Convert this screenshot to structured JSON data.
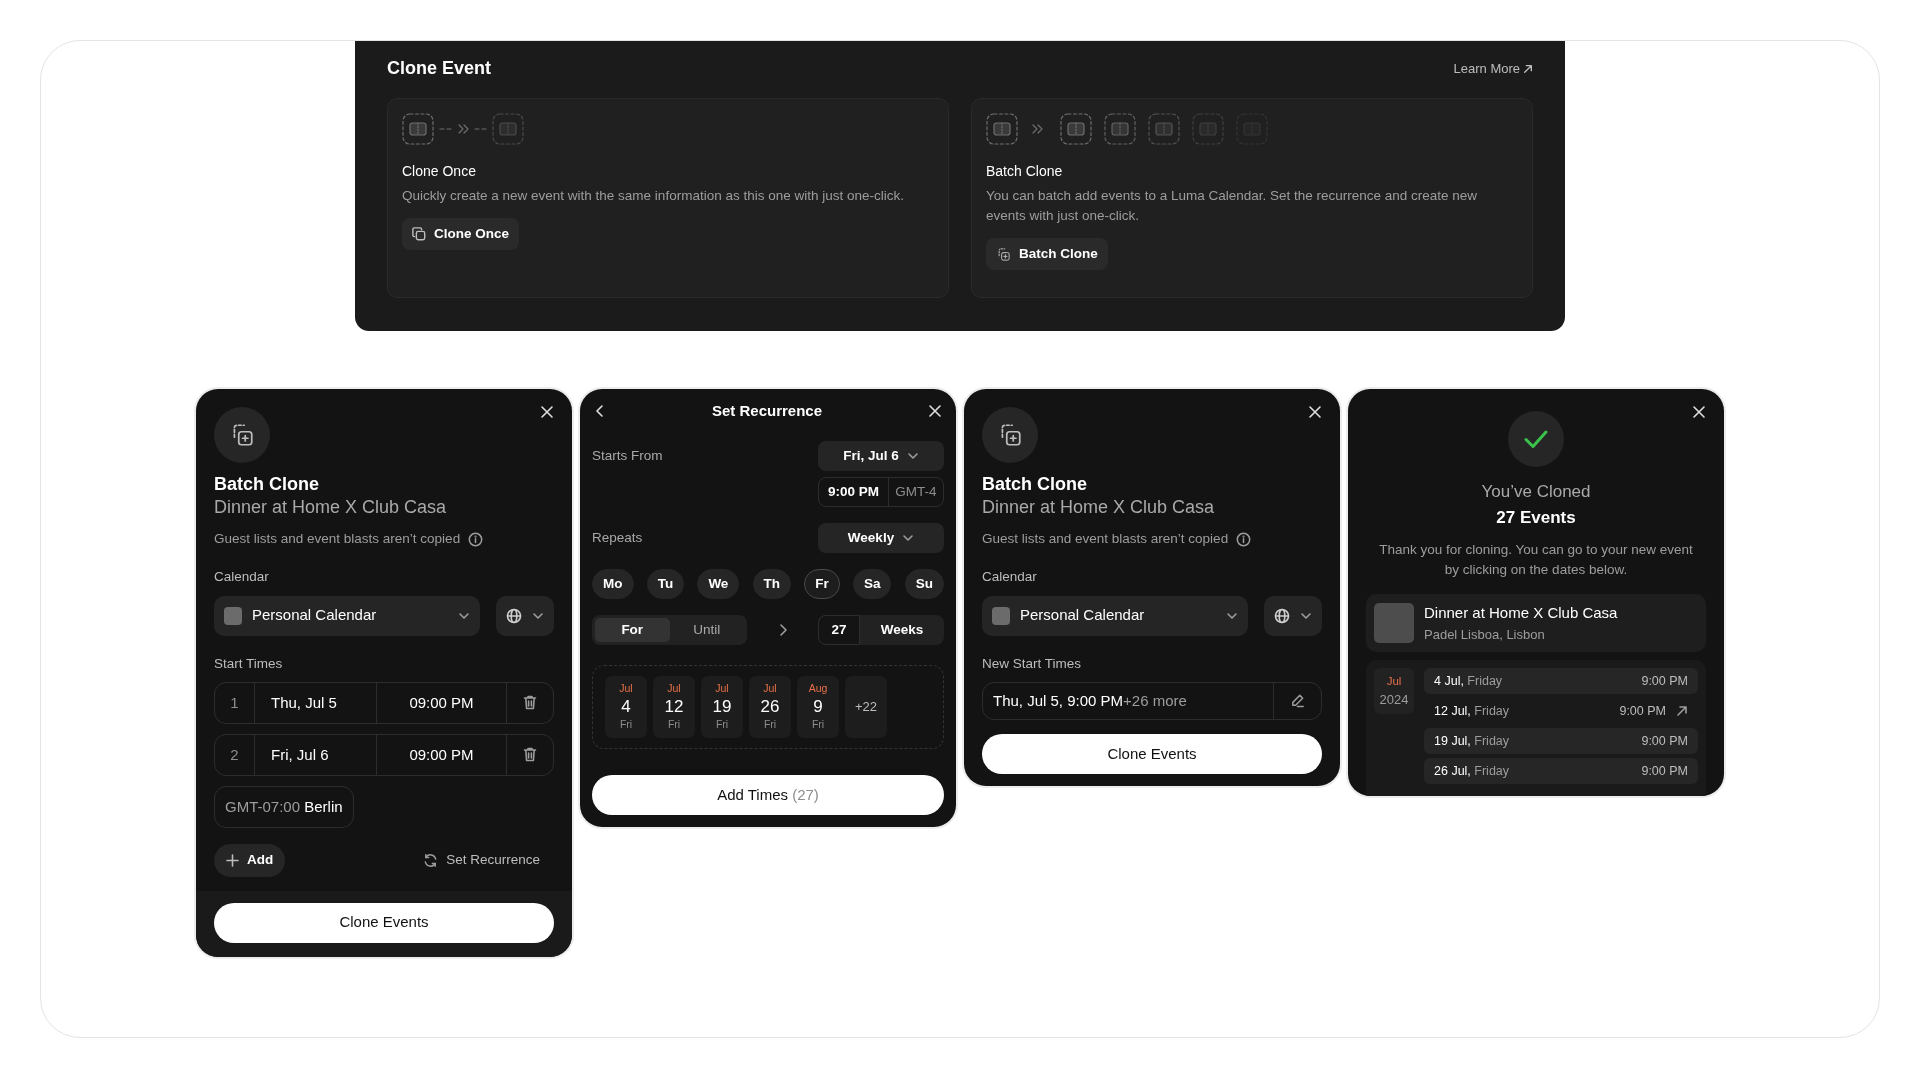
{
  "clone_event": {
    "title": "Clone Event",
    "learn_more": "Learn More",
    "options": [
      {
        "kind": "once",
        "title": "Clone Once",
        "description": "Quickly create a new event with the same information as this one with just one-click.",
        "button": "Clone Once"
      },
      {
        "kind": "batch",
        "title": "Batch Clone",
        "description": "You can batch add events to a Luma Calendar. Set the recurrence and create new events with just one-click.",
        "button": "Batch Clone"
      }
    ]
  },
  "batch_clone_form": {
    "title": "Batch Clone",
    "event_name": "Dinner at Home X Club Casa",
    "note": "Guest lists and event blasts aren’t copied",
    "calendar_label": "Calendar",
    "calendar": "Personal Calendar",
    "start_times_label": "Start Times",
    "start_times": [
      {
        "index": "1",
        "date": "Thu, Jul 5",
        "time": "09:00 PM"
      },
      {
        "index": "2",
        "date": "Fri, Jul 6",
        "time": "09:00 PM"
      }
    ],
    "timezone": "GMT-07:00 **Berlin**",
    "add_button": "Add",
    "recurrence_button": "Set Recurrence",
    "submit_button": "Clone Events"
  },
  "set_recurrence": {
    "title": "Set Recurrence",
    "starts_from_label": "Starts From",
    "start_date": "Fri, Jul 6",
    "start_time": "9:00 PM",
    "timezone": "GMT-4",
    "repeats_label": "Repeats",
    "repeats": "Weekly",
    "weekdays": [
      {
        "label": "Mo",
        "selected": false
      },
      {
        "label": "Tu",
        "selected": false
      },
      {
        "label": "We",
        "selected": false
      },
      {
        "label": "Th",
        "selected": false
      },
      {
        "label": "Fr",
        "selected": true
      },
      {
        "label": "Sa",
        "selected": false
      },
      {
        "label": "Su",
        "selected": false
      }
    ],
    "end_modes": [
      {
        "label": "For",
        "selected": true
      },
      {
        "label": "Until",
        "selected": false
      }
    ],
    "count": "27",
    "unit": "Weeks",
    "preview": [
      {
        "month": "Jul",
        "day": "4",
        "weekday": "Fri"
      },
      {
        "month": "Jul",
        "day": "12",
        "weekday": "Fri"
      },
      {
        "month": "Jul",
        "day": "19",
        "weekday": "Fri"
      },
      {
        "month": "Jul",
        "day": "26",
        "weekday": "Fri"
      },
      {
        "month": "Aug",
        "day": "9",
        "weekday": "Fri"
      }
    ],
    "more": "+22",
    "submit_label": "Add Times",
    "submit_count": "(27)"
  },
  "batch_clone_summary": {
    "title": "Batch Clone",
    "event_name": "Dinner at Home X Club Casa",
    "note": "Guest lists and event blasts aren’t copied",
    "calendar_label": "Calendar",
    "calendar": "Personal Calendar",
    "start_times_label": "New Start Times",
    "start_times": "Thu, Jul 5, 9:00 PM",
    "more": "+26 more",
    "submit_button": "Clone Events"
  },
  "success": {
    "title": "You’ve Cloned",
    "count": "27 Events",
    "message": "Thank you for cloning. You can go to your new event by clicking on the dates below.",
    "event": {
      "name": "Dinner at Home X Club Casa",
      "location": "Padel Lisboa, Lisbon"
    },
    "groups": [
      {
        "month": "Jul",
        "year": "2024",
        "dates": [
          {
            "date": "4 Jul,",
            "weekday": "Friday",
            "time": "9:00 PM",
            "hovered": false
          },
          {
            "date": "12 Jul,",
            "weekday": "Friday",
            "time": "9:00 PM",
            "hovered": true
          },
          {
            "date": "19 Jul,",
            "weekday": "Friday",
            "time": "9:00 PM",
            "hovered": false
          },
          {
            "date": "26 Jul,",
            "weekday": "Friday",
            "time": "9:00 PM",
            "hovered": false
          }
        ]
      }
    ]
  }
}
